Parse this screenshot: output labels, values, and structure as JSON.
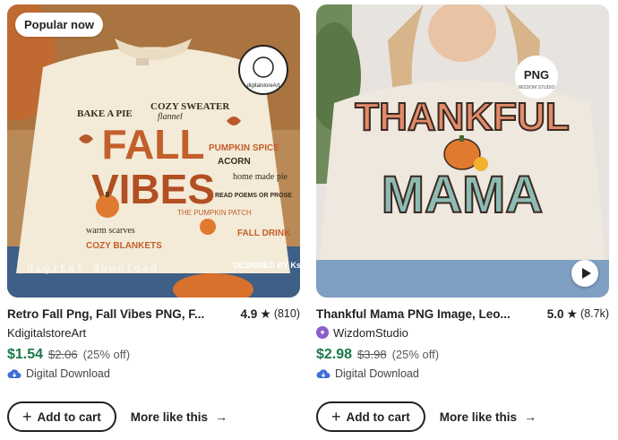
{
  "cards": [
    {
      "badge": "Popular now",
      "title": "Retro Fall Png, Fall Vibes PNG, F...",
      "rating": "4.9",
      "review_count": "(810)",
      "shop": "KdigitalstoreArt",
      "star_seller": false,
      "price": "$1.54",
      "original_price": "$2.06",
      "discount": "(25% off)",
      "download_label": "Digital Download",
      "add_to_cart": "Add to cart",
      "more_like_this": "More like this",
      "image": {
        "main_text": [
          "FALL",
          "VIBES"
        ],
        "words": [
          "BAKE A PIE",
          "COZY SWEATER",
          "PUMPKIN SPICE",
          "ACORN",
          "COZY BLANKETS",
          "FALL DRINK",
          "home made pie",
          "flannel",
          "warm scarves",
          "THE PUMPKIN PATCH",
          "READ POEMS OR PROSE"
        ],
        "watermark": "digital download",
        "designed_by": "DESIGNED BY Kstudio",
        "logo_text": "digitalstoreArt"
      }
    },
    {
      "badge": "",
      "title": "Thankful Mama PNG Image, Leo...",
      "rating": "5.0",
      "review_count": "(8.7k)",
      "shop": "WizdomStudio",
      "star_seller": true,
      "price": "$2.98",
      "original_price": "$3.98",
      "discount": "(25% off)",
      "download_label": "Digital Download",
      "add_to_cart": "Add to cart",
      "more_like_this": "More like this",
      "image": {
        "main_text": [
          "THANKFUL",
          "MAMA"
        ],
        "logo_text": "PNG",
        "logo_subtext": "WIZDOM STUDIO"
      }
    }
  ],
  "colors": {
    "sale_price": "#1a7a4b",
    "star_seller": "#8a5fc8",
    "download_icon": "#3d6fd6"
  }
}
